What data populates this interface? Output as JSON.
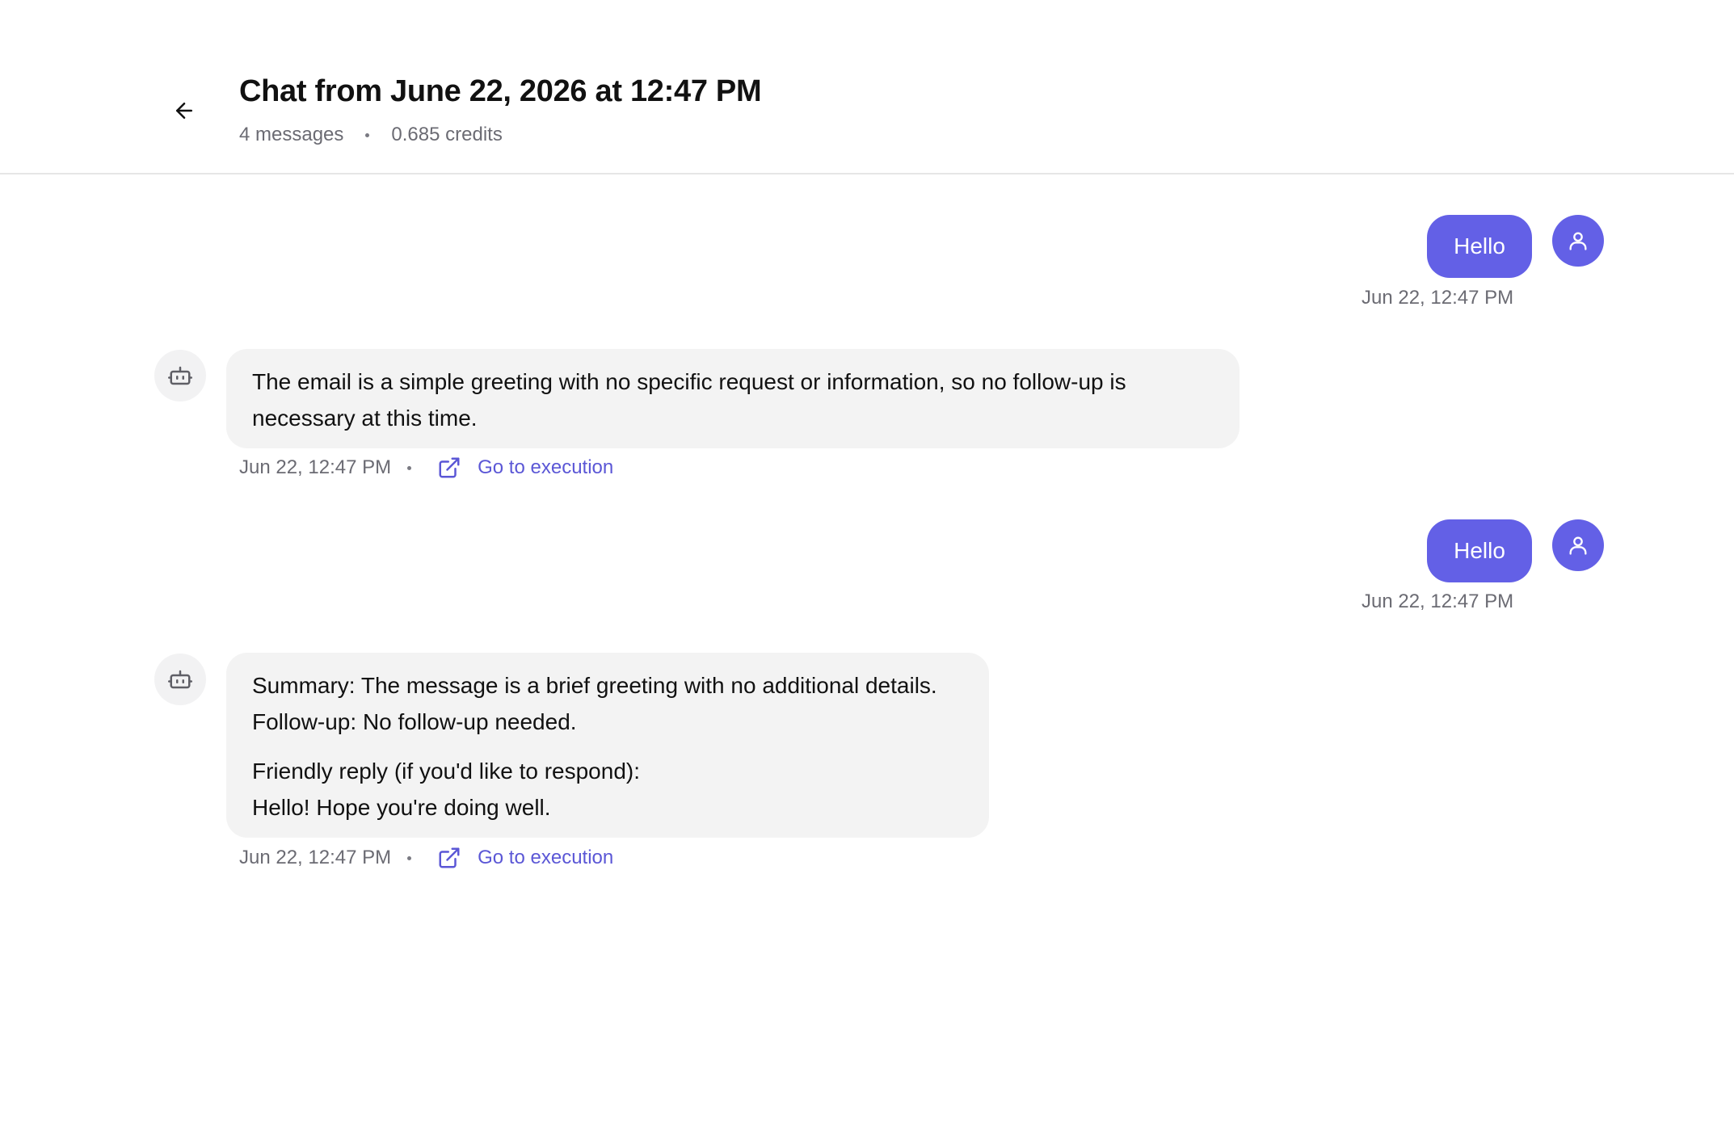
{
  "header": {
    "title": "Chat from June 22, 2026 at 12:47 PM",
    "message_count": "4 messages",
    "credits": "0.685 credits"
  },
  "icons": {
    "back": "arrow-left-icon",
    "user": "user-icon",
    "bot": "bot-icon",
    "external_link": "external-link-icon"
  },
  "colors": {
    "accent": "#6360e6",
    "link": "#5b57d6",
    "bot_bubble": "#f3f3f3",
    "muted_text": "#6b6b73"
  },
  "messages": [
    {
      "role": "user",
      "text": "Hello",
      "timestamp": "Jun 22, 12:47 PM"
    },
    {
      "role": "assistant",
      "paragraphs": [
        "The email is a simple greeting with no specific request or information, so no follow-up is necessary at this time."
      ],
      "timestamp": "Jun 22, 12:47 PM",
      "link_label": "Go to execution"
    },
    {
      "role": "user",
      "text": "Hello",
      "timestamp": "Jun 22, 12:47 PM"
    },
    {
      "role": "assistant",
      "paragraphs": [
        "Summary: The message is a brief greeting with no additional details.\nFollow-up: No follow-up needed.",
        "Friendly reply (if you'd like to respond):\nHello! Hope you're doing well."
      ],
      "timestamp": "Jun 22, 12:47 PM",
      "link_label": "Go to execution"
    }
  ]
}
